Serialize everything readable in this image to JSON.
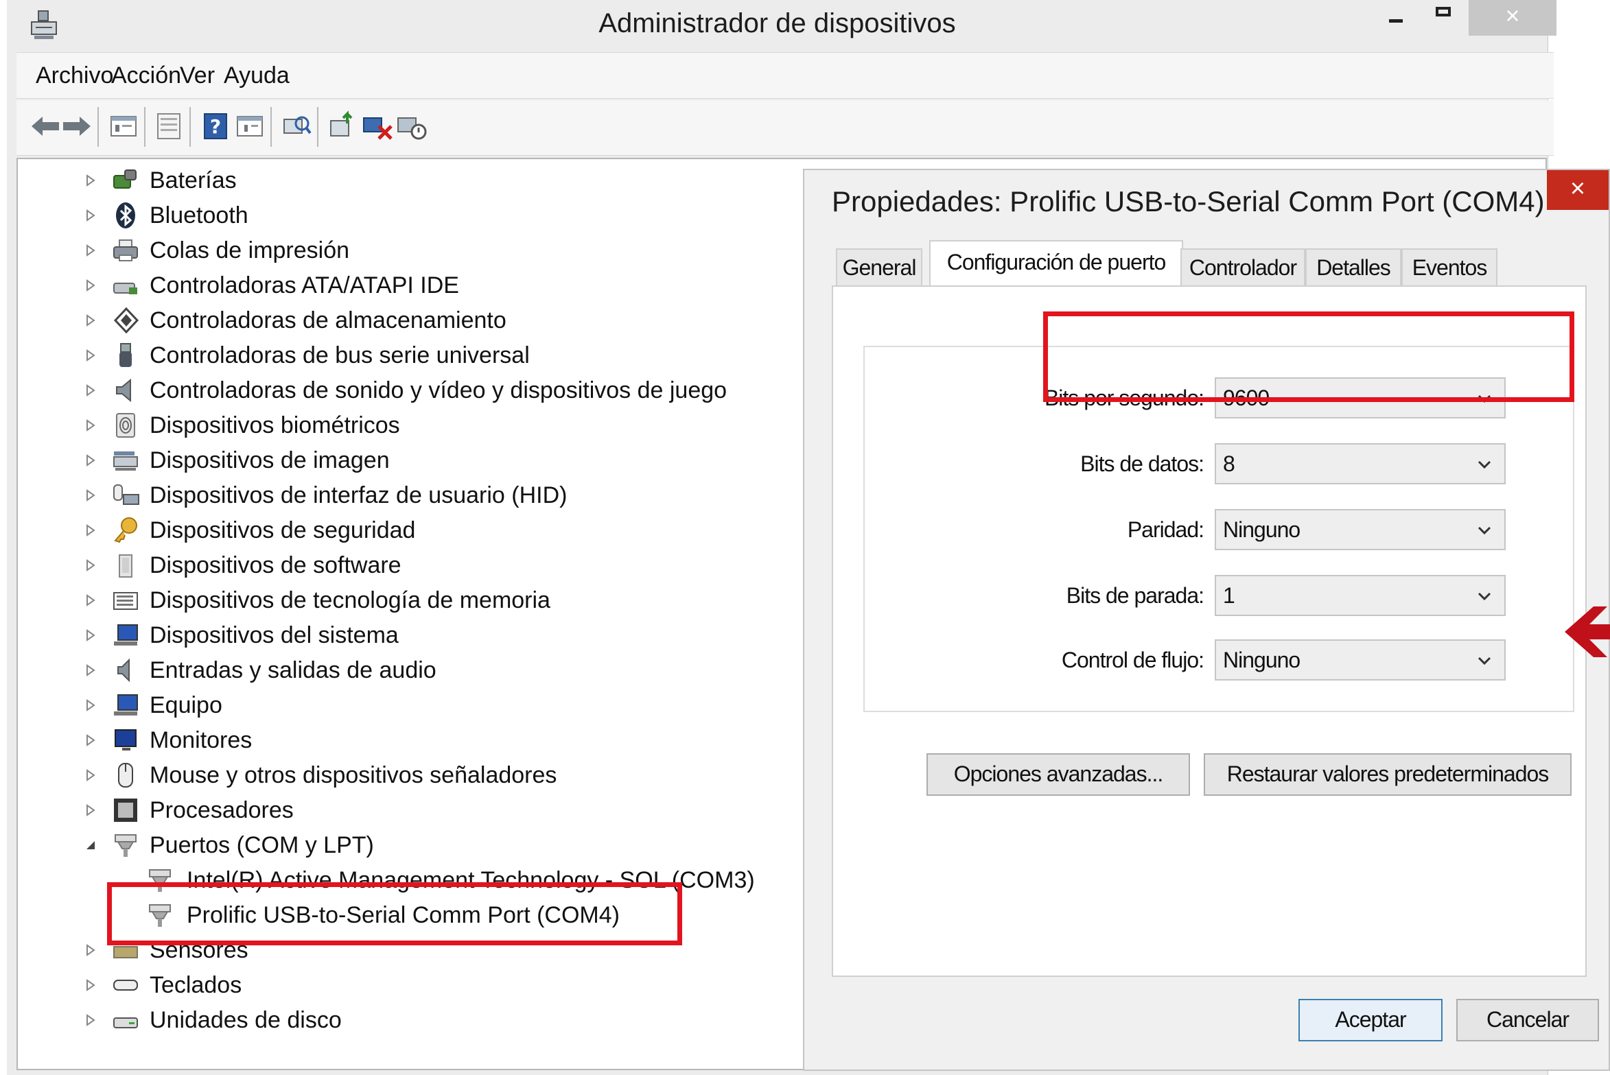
{
  "window": {
    "title": "Administrador de dispositivos",
    "close_glyph": "×"
  },
  "menu": [
    "Archivo",
    "Acción",
    "Ver",
    "Ayuda"
  ],
  "toolbar_icons": [
    "back-arrow-icon",
    "forward-arrow-icon",
    "properties-icon",
    "view-icon",
    "help-icon",
    "action-view-icon",
    "scan-hardware-icon",
    "update-driver-icon",
    "uninstall-device-icon",
    "disable-device-icon"
  ],
  "tree": {
    "items": [
      {
        "label": "Baterías",
        "icon": "battery-icon"
      },
      {
        "label": "Bluetooth",
        "icon": "bluetooth-icon"
      },
      {
        "label": "Colas de impresión",
        "icon": "printer-icon"
      },
      {
        "label": "Controladoras ATA/ATAPI IDE",
        "icon": "ide-controller-icon"
      },
      {
        "label": "Controladoras de almacenamiento",
        "icon": "storage-controller-icon"
      },
      {
        "label": "Controladoras de bus serie universal",
        "icon": "usb-icon"
      },
      {
        "label": "Controladoras de sonido y vídeo y dispositivos de juego",
        "icon": "speaker-icon"
      },
      {
        "label": "Dispositivos biométricos",
        "icon": "fingerprint-icon"
      },
      {
        "label": "Dispositivos de imagen",
        "icon": "scanner-icon"
      },
      {
        "label": "Dispositivos de interfaz de usuario (HID)",
        "icon": "hid-icon"
      },
      {
        "label": "Dispositivos de seguridad",
        "icon": "key-icon"
      },
      {
        "label": "Dispositivos de software",
        "icon": "software-device-icon"
      },
      {
        "label": "Dispositivos de tecnología de memoria",
        "icon": "memory-card-icon"
      },
      {
        "label": "Dispositivos del sistema",
        "icon": "system-device-icon"
      },
      {
        "label": "Entradas y salidas de audio",
        "icon": "audio-icon"
      },
      {
        "label": "Equipo",
        "icon": "computer-icon"
      },
      {
        "label": "Monitores",
        "icon": "monitor-icon"
      },
      {
        "label": "Mouse y otros dispositivos señaladores",
        "icon": "mouse-icon"
      },
      {
        "label": "Procesadores",
        "icon": "processor-icon"
      },
      {
        "label": "Puertos (COM y LPT)",
        "icon": "port-icon",
        "expanded": true
      },
      {
        "label": "Intel(R) Active Management Technology - SOL (COM3)",
        "icon": "port-icon",
        "child": true
      },
      {
        "label": "Prolific USB-to-Serial Comm Port (COM4)",
        "icon": "port-icon",
        "child": true,
        "highlighted": true
      },
      {
        "label": "Sensores",
        "icon": "sensor-icon"
      },
      {
        "label": "Teclados",
        "icon": "keyboard-icon"
      },
      {
        "label": "Unidades de disco",
        "icon": "disk-drive-icon"
      }
    ]
  },
  "dialog": {
    "title": "Propiedades: Prolific USB-to-Serial Comm Port (COM4)",
    "close_glyph": "×",
    "tabs": [
      "General",
      "Configuración de puerto",
      "Controlador",
      "Detalles",
      "Eventos"
    ],
    "active_tab": 1,
    "fields": {
      "bits_por_segundo": {
        "label": "Bits por segundo:",
        "value": "9600"
      },
      "bits_de_datos": {
        "label": "Bits de datos:",
        "value": "8"
      },
      "paridad": {
        "label": "Paridad:",
        "value": "Ninguno"
      },
      "bits_de_parada": {
        "label": "Bits de parada:",
        "value": "1"
      },
      "control_de_flujo": {
        "label": "Control de flujo:",
        "value": "Ninguno"
      }
    },
    "buttons": {
      "advanced": "Opciones avanzadas...",
      "restore": "Restaurar valores predeterminados",
      "ok": "Aceptar",
      "cancel": "Cancelar"
    }
  },
  "colors": {
    "highlight": "#e2141e",
    "arrow": "#c0101a",
    "close": "#c42b1c"
  }
}
